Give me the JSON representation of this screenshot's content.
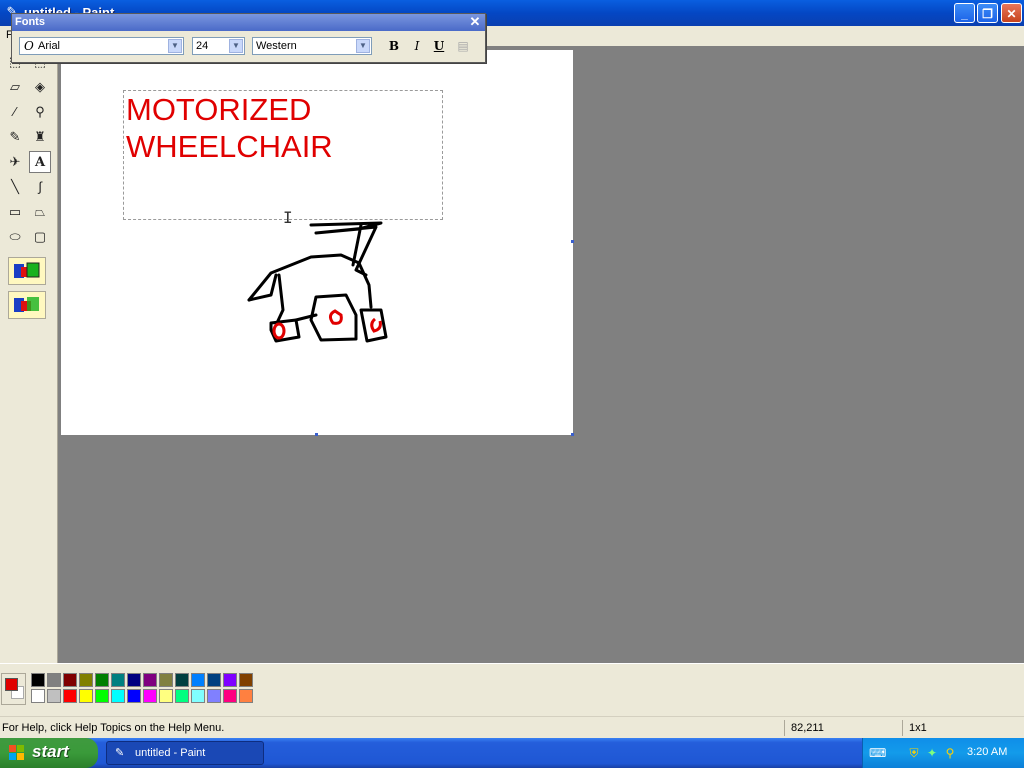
{
  "window": {
    "title": "untitled - Paint"
  },
  "menu": {
    "items": [
      "F"
    ]
  },
  "fonts_toolbar": {
    "title": "Fonts",
    "font_name": "Arial",
    "font_size": "24",
    "script": "Western",
    "bold": "B",
    "italic": "I",
    "underline": "U"
  },
  "canvas": {
    "text_lines": [
      "MOTORIZED",
      "WHEELCHAIR"
    ]
  },
  "palette": {
    "foreground": "#e00000",
    "background": "#ffffff",
    "colors_row1": [
      "#000000",
      "#808080",
      "#800000",
      "#808000",
      "#008000",
      "#008080",
      "#000080",
      "#800080",
      "#808040",
      "#004040",
      "#0080ff",
      "#004080",
      "#8000ff",
      "#804000"
    ],
    "colors_row2": [
      "#ffffff",
      "#c0c0c0",
      "#ff0000",
      "#ffff00",
      "#00ff00",
      "#00ffff",
      "#0000ff",
      "#ff00ff",
      "#ffff80",
      "#00ff80",
      "#80ffff",
      "#8080ff",
      "#ff0080",
      "#ff8040"
    ]
  },
  "status": {
    "help": "For Help, click Help Topics on the Help Menu.",
    "coords": "82,211",
    "size": "1x1"
  },
  "taskbar": {
    "start_label": "start",
    "task_label": "untitled - Paint",
    "clock": "3:20 AM"
  }
}
